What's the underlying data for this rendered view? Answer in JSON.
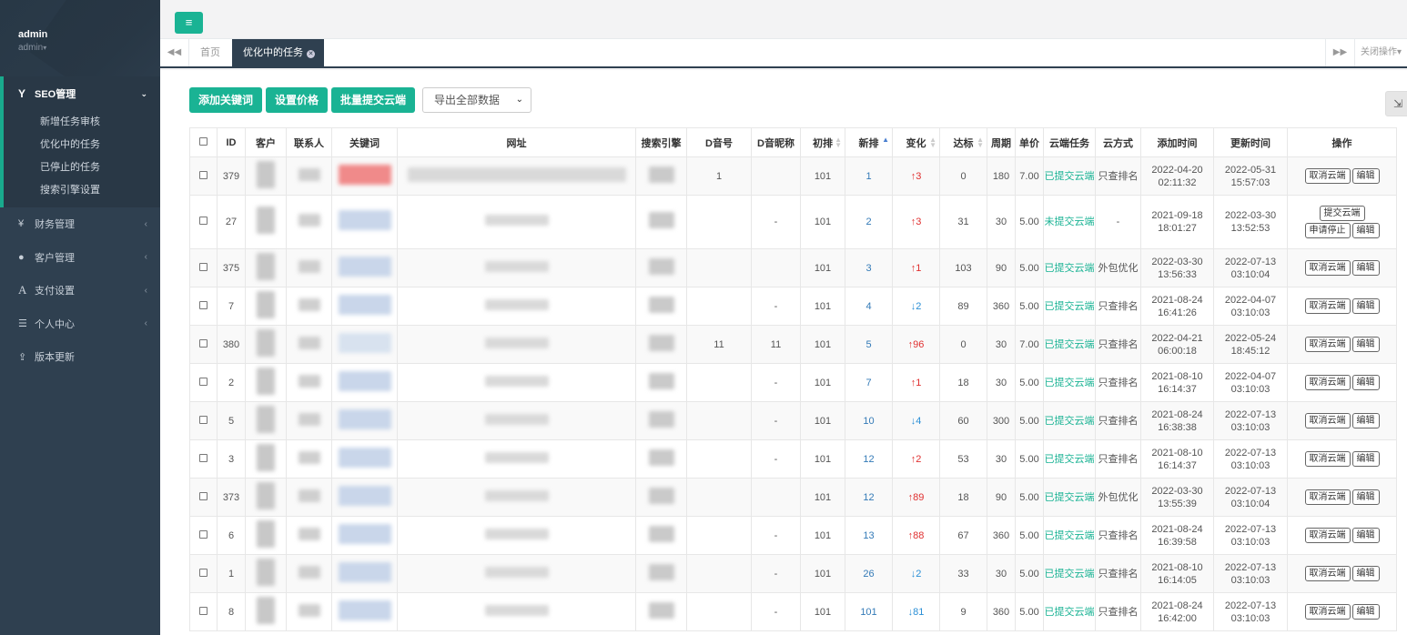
{
  "user": {
    "name": "admin",
    "role": "admin"
  },
  "sidebar": {
    "seo": {
      "label": "SEO管理",
      "items": [
        "新增任务审核",
        "优化中的任务",
        "已停止的任务",
        "搜索引擎设置"
      ]
    },
    "items": [
      {
        "label": "财务管理",
        "icon": "yen-icon"
      },
      {
        "label": "客户管理",
        "icon": "user-icon"
      },
      {
        "label": "支付设置",
        "icon": "font-icon"
      },
      {
        "label": "个人中心",
        "icon": "server-icon"
      },
      {
        "label": "版本更新",
        "icon": "upload-icon"
      }
    ]
  },
  "tabs": {
    "home": "首页",
    "active": "优化中的任务",
    "close_ops": "关闭操作"
  },
  "toolbar": {
    "add_keyword": "添加关键词",
    "set_price": "设置价格",
    "batch_submit": "批量提交云端",
    "export": "导出全部数据"
  },
  "table": {
    "headers": [
      "ID",
      "客户",
      "联系人",
      "关键词",
      "网址",
      "搜索引擎",
      "D音号",
      "D音昵称",
      "初排",
      "新排",
      "变化",
      "达标",
      "周期",
      "单价",
      "云端任务",
      "云方式",
      "添加时间",
      "更新时间",
      "操作"
    ],
    "rows": [
      {
        "id": "379",
        "douyin_id": "1",
        "douyin_nick": "",
        "initial": "101",
        "new": "1",
        "change": "↑3",
        "dir": "up",
        "reached": "0",
        "cycle": "180",
        "price": "7.00",
        "cloud": "已提交云端",
        "mode": "只查排名",
        "added": "2022-04-20 02:11:32",
        "updated": "2022-05-31 15:57:03",
        "actions": [
          "取消云端",
          "编辑"
        ]
      },
      {
        "id": "27",
        "douyin_id": "",
        "douyin_nick": "-",
        "initial": "101",
        "new": "2",
        "change": "↑3",
        "dir": "up",
        "reached": "31",
        "cycle": "30",
        "price": "5.00",
        "cloud": "未提交云端",
        "mode": "-",
        "added": "2021-09-18 18:01:27",
        "updated": "2022-03-30 13:52:53",
        "actions": [
          "提交云端",
          "申请停止",
          "编辑"
        ]
      },
      {
        "id": "375",
        "douyin_id": "",
        "douyin_nick": "",
        "initial": "101",
        "new": "3",
        "change": "↑1",
        "dir": "up",
        "reached": "103",
        "cycle": "90",
        "price": "5.00",
        "cloud": "已提交云端",
        "mode": "外包优化",
        "added": "2022-03-30 13:56:33",
        "updated": "2022-07-13 03:10:04",
        "actions": [
          "取消云端",
          "编辑"
        ]
      },
      {
        "id": "7",
        "douyin_id": "",
        "douyin_nick": "-",
        "initial": "101",
        "new": "4",
        "change": "↓2",
        "dir": "down",
        "reached": "89",
        "cycle": "360",
        "price": "5.00",
        "cloud": "已提交云端",
        "mode": "只查排名",
        "added": "2021-08-24 16:41:26",
        "updated": "2022-04-07 03:10:03",
        "actions": [
          "取消云端",
          "编辑"
        ]
      },
      {
        "id": "380",
        "douyin_id": "11",
        "douyin_nick": "11",
        "initial": "101",
        "new": "5",
        "change": "↑96",
        "dir": "up",
        "reached": "0",
        "cycle": "30",
        "price": "7.00",
        "cloud": "已提交云端",
        "mode": "只查排名",
        "added": "2022-04-21 06:00:18",
        "updated": "2022-05-24 18:45:12",
        "actions": [
          "取消云端",
          "编辑"
        ]
      },
      {
        "id": "2",
        "douyin_id": "",
        "douyin_nick": "-",
        "initial": "101",
        "new": "7",
        "change": "↑1",
        "dir": "up",
        "reached": "18",
        "cycle": "30",
        "price": "5.00",
        "cloud": "已提交云端",
        "mode": "只查排名",
        "added": "2021-08-10 16:14:37",
        "updated": "2022-04-07 03:10:03",
        "actions": [
          "取消云端",
          "编辑"
        ]
      },
      {
        "id": "5",
        "douyin_id": "",
        "douyin_nick": "-",
        "initial": "101",
        "new": "10",
        "change": "↓4",
        "dir": "down",
        "reached": "60",
        "cycle": "300",
        "price": "5.00",
        "cloud": "已提交云端",
        "mode": "只查排名",
        "added": "2021-08-24 16:38:38",
        "updated": "2022-07-13 03:10:03",
        "actions": [
          "取消云端",
          "编辑"
        ]
      },
      {
        "id": "3",
        "douyin_id": "",
        "douyin_nick": "-",
        "initial": "101",
        "new": "12",
        "change": "↑2",
        "dir": "up",
        "reached": "53",
        "cycle": "30",
        "price": "5.00",
        "cloud": "已提交云端",
        "mode": "只查排名",
        "added": "2021-08-10 16:14:37",
        "updated": "2022-07-13 03:10:03",
        "actions": [
          "取消云端",
          "编辑"
        ]
      },
      {
        "id": "373",
        "douyin_id": "",
        "douyin_nick": "",
        "initial": "101",
        "new": "12",
        "change": "↑89",
        "dir": "up",
        "reached": "18",
        "cycle": "90",
        "price": "5.00",
        "cloud": "已提交云端",
        "mode": "外包优化",
        "added": "2022-03-30 13:55:39",
        "updated": "2022-07-13 03:10:04",
        "actions": [
          "取消云端",
          "编辑"
        ]
      },
      {
        "id": "6",
        "douyin_id": "",
        "douyin_nick": "-",
        "initial": "101",
        "new": "13",
        "change": "↑88",
        "dir": "up",
        "reached": "67",
        "cycle": "360",
        "price": "5.00",
        "cloud": "已提交云端",
        "mode": "只查排名",
        "added": "2021-08-24 16:39:58",
        "updated": "2022-07-13 03:10:03",
        "actions": [
          "取消云端",
          "编辑"
        ]
      },
      {
        "id": "1",
        "douyin_id": "",
        "douyin_nick": "-",
        "initial": "101",
        "new": "26",
        "change": "↓2",
        "dir": "down",
        "reached": "33",
        "cycle": "30",
        "price": "5.00",
        "cloud": "已提交云端",
        "mode": "只查排名",
        "added": "2021-08-10 16:14:05",
        "updated": "2022-07-13 03:10:03",
        "actions": [
          "取消云端",
          "编辑"
        ]
      },
      {
        "id": "8",
        "douyin_id": "",
        "douyin_nick": "-",
        "initial": "101",
        "new": "101",
        "change": "↓81",
        "dir": "down",
        "reached": "9",
        "cycle": "360",
        "price": "5.00",
        "cloud": "已提交云端",
        "mode": "只查排名",
        "added": "2021-08-24 16:42:00",
        "updated": "2022-07-13 03:10:03",
        "actions": [
          "取消云端",
          "编辑"
        ]
      }
    ]
  },
  "colors": {
    "accent": "#1ab394",
    "sidebar": "#2f4050",
    "up": "#e03030",
    "down": "#2a8fd6"
  }
}
